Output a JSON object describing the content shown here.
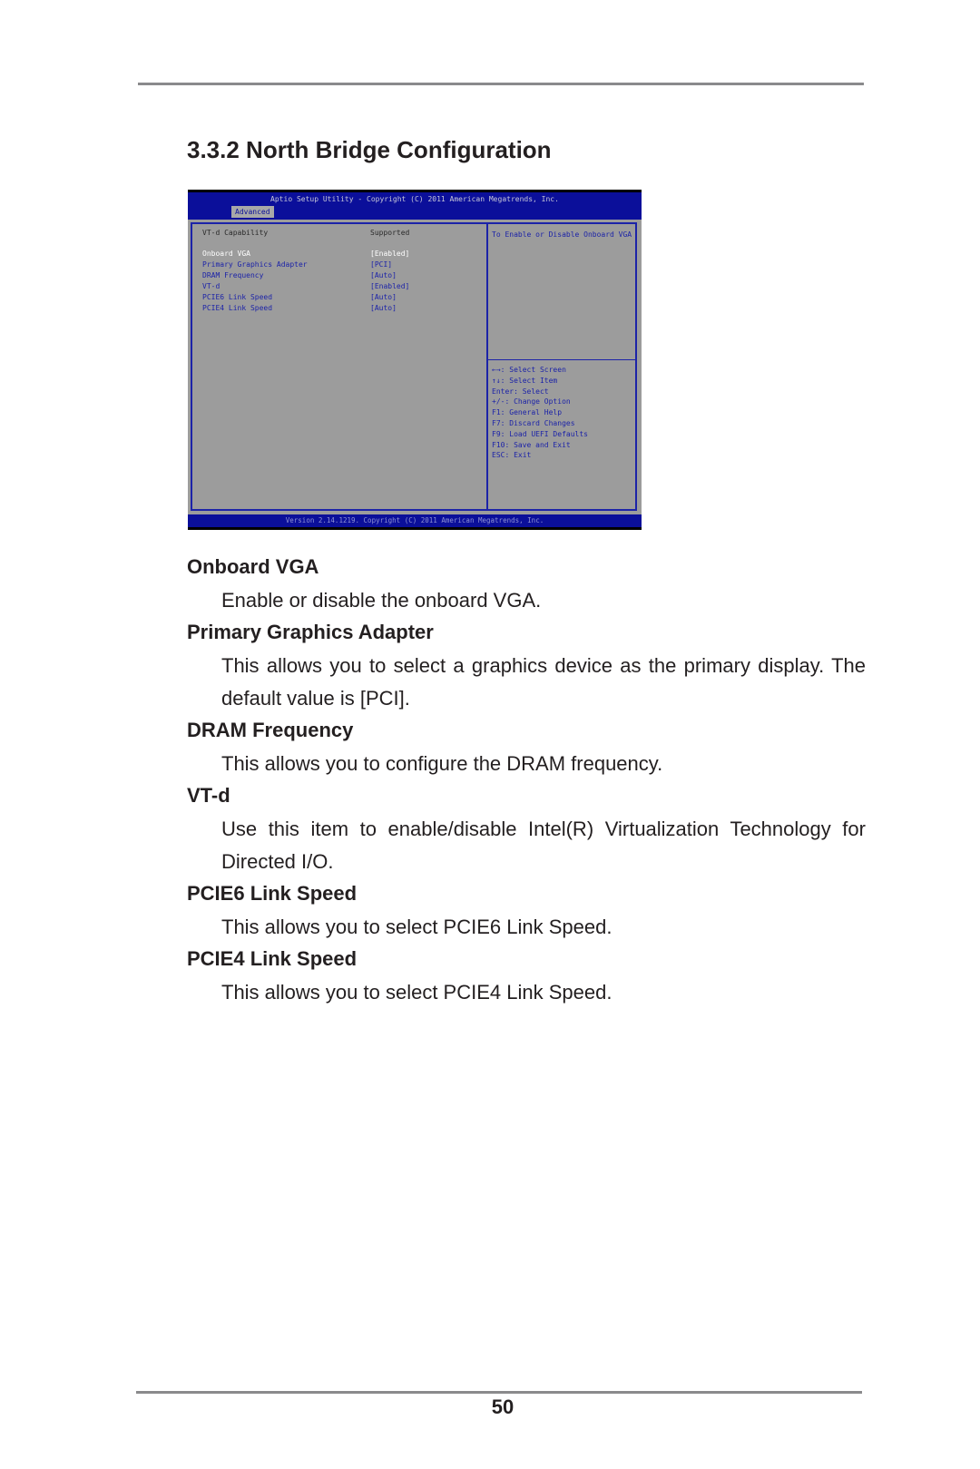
{
  "section": {
    "number": "3.3.2",
    "title": "3.3.2  North Bridge Configuration"
  },
  "bios": {
    "title": "Aptio Setup Utility - Copyright (C) 2011 American Megatrends, Inc.",
    "active_tab": "Advanced",
    "rows": [
      {
        "label": "VT-d Capability",
        "value": "Supported",
        "type": "static"
      },
      {
        "label": "Onboard VGA",
        "value": "[Enabled]",
        "type": "selected"
      },
      {
        "label": "Primary Graphics Adapter",
        "value": "[PCI]",
        "type": "link"
      },
      {
        "label": "DRAM Frequency",
        "value": "[Auto]",
        "type": "link"
      },
      {
        "label": "VT-d",
        "value": "[Enabled]",
        "type": "link"
      },
      {
        "label": "PCIE6 Link Speed",
        "value": "[Auto]",
        "type": "link"
      },
      {
        "label": "PCIE4 Link Speed",
        "value": "[Auto]",
        "type": "link"
      }
    ],
    "help_text": "To Enable or Disable Onboard VGA",
    "keys": [
      "←→: Select Screen",
      "↑↓: Select Item",
      "Enter: Select",
      "+/-: Change Option",
      "F1: General Help",
      "F7: Discard Changes",
      "F9: Load UEFI Defaults",
      "F10: Save and Exit",
      "ESC: Exit"
    ],
    "footer": "Version 2.14.1219. Copyright (C) 2011 American Megatrends, Inc.",
    "colors": {
      "header_blue": "#0b0f9a",
      "body_gray": "#9c9c9c",
      "link_blue": "#1c23a8"
    }
  },
  "items": [
    {
      "heading": "Onboard VGA",
      "description": "Enable or disable the onboard VGA."
    },
    {
      "heading": "Primary Graphics Adapter",
      "description": "This allows you to select a graphics device as the primary display. The default value is [PCI]."
    },
    {
      "heading": "DRAM Frequency",
      "description": "This allows you to configure the DRAM frequency."
    },
    {
      "heading": "VT-d",
      "description": "Use this item to enable/disable Intel(R) Virtualization Technology for Directed I/O."
    },
    {
      "heading": "PCIE6 Link Speed",
      "description": "This allows you to select PCIE6 Link Speed."
    },
    {
      "heading": "PCIE4 Link Speed",
      "description": "This allows you to select PCIE4 Link Speed."
    }
  ],
  "page_number": "50"
}
